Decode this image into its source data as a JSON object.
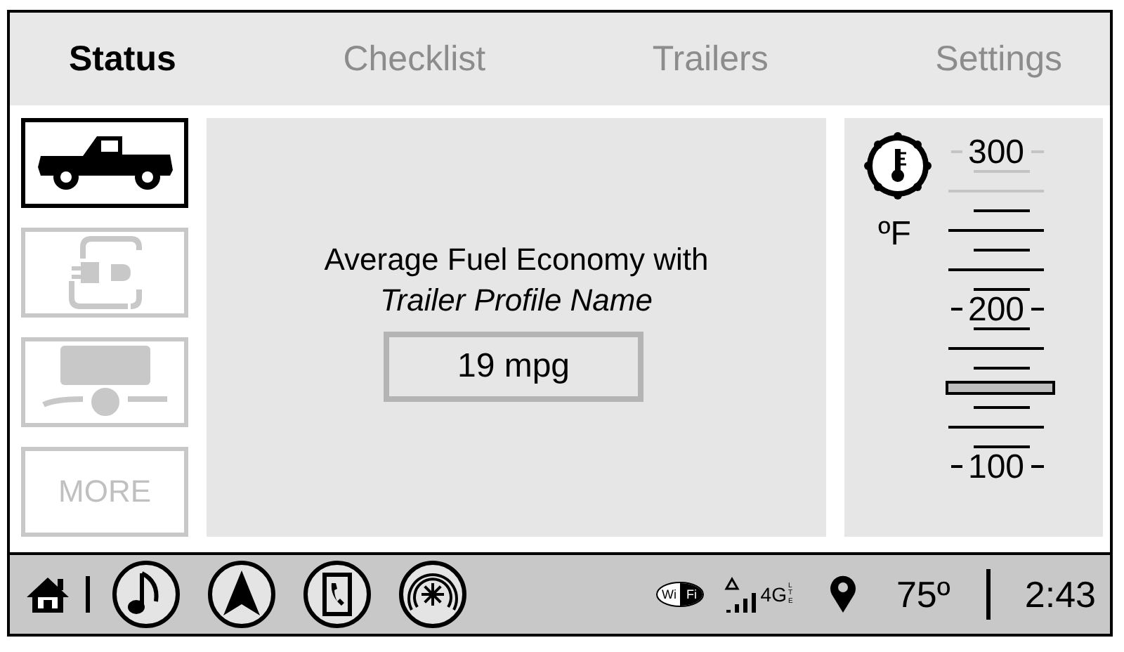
{
  "tabs": [
    {
      "label": "Status",
      "selected": true
    },
    {
      "label": "Checklist",
      "selected": false
    },
    {
      "label": "Trailers",
      "selected": false
    },
    {
      "label": "Settings",
      "selected": false
    }
  ],
  "sidebar": {
    "items": [
      {
        "kind": "truck",
        "selected": true
      },
      {
        "kind": "plug",
        "selected": false
      },
      {
        "kind": "trailer",
        "selected": false
      },
      {
        "kind": "text",
        "label": "MORE",
        "selected": false
      }
    ]
  },
  "fuel_panel": {
    "title": "Average Fuel Economy with",
    "profile": "Trailer Profile Name",
    "value": "19 mpg"
  },
  "gauge": {
    "unit": "ºF",
    "labels": [
      "300",
      "200",
      "100"
    ]
  },
  "dock": {
    "apps": [
      {
        "kind": "music"
      },
      {
        "kind": "navigation"
      },
      {
        "kind": "phone"
      },
      {
        "kind": "climate"
      }
    ]
  },
  "status": {
    "wifi": [
      "Wi",
      "Fi"
    ],
    "network": "4G",
    "network_sub": "LTE",
    "temperature": "75º",
    "time": "2:43"
  }
}
